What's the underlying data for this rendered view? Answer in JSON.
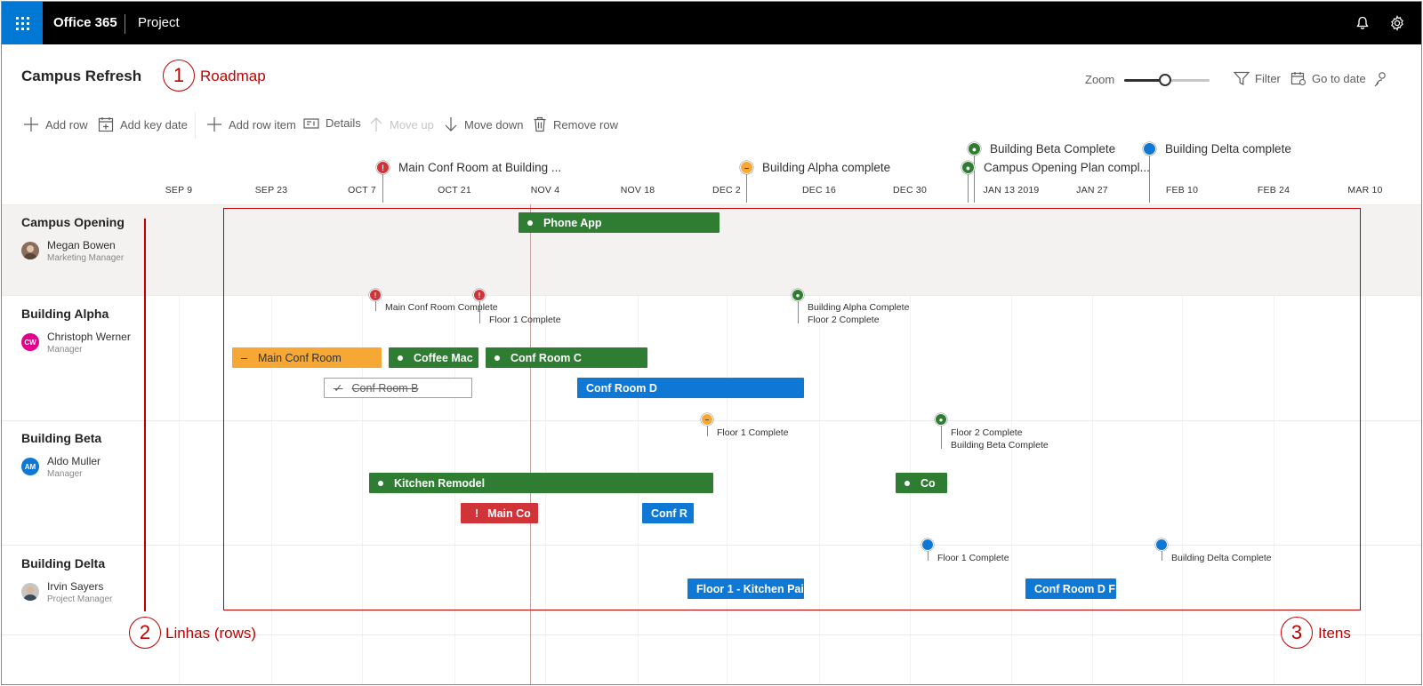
{
  "topbar": {
    "brand": "Office 365",
    "app": "Project"
  },
  "project": {
    "title": "Campus Refresh"
  },
  "callouts": [
    {
      "num": "1",
      "text": "Roadmap"
    },
    {
      "num": "2",
      "text": "Linhas (rows)"
    },
    {
      "num": "3",
      "text": "Itens"
    }
  ],
  "header": {
    "zoom_label": "Zoom",
    "zoom_level": 0.48,
    "filter": "Filter",
    "go_to_date": "Go to date"
  },
  "toolbar": {
    "add_row": "Add row",
    "add_key_date": "Add key date",
    "add_row_item": "Add row item",
    "details": "Details",
    "move_up": "Move up",
    "move_down": "Move down",
    "remove_row": "Remove row"
  },
  "timeline": {
    "dates": [
      "SEP 9",
      "SEP 23",
      "OCT 7",
      "OCT 21",
      "NOV 4",
      "NOV 18",
      "DEC 2",
      "DEC 16",
      "DEC 30",
      "JAN 13 2019",
      "JAN 27",
      "FEB 10",
      "FEB 24",
      "MAR 10"
    ],
    "key_dates": [
      "Main Conf Room at Building ...",
      "Building Alpha complete",
      "Building Beta Complete",
      "Campus Opening Plan compl...",
      "Building Delta complete"
    ]
  },
  "rows": [
    {
      "title": "Campus Opening",
      "person": "Megan Bowen",
      "role": "Marketing Manager",
      "initials": ""
    },
    {
      "title": "Building Alpha",
      "person": "Christoph Werner",
      "role": "Manager",
      "initials": "CW"
    },
    {
      "title": "Building Beta",
      "person": "Aldo Muller",
      "role": "Manager",
      "initials": "AM"
    },
    {
      "title": "Building Delta",
      "person": "Irvin Sayers",
      "role": "Project Manager",
      "initials": ""
    }
  ],
  "items": {
    "phone_app": "Phone App",
    "main_conf_room": "Main Conf Room",
    "coffee_mac": "Coffee Mac",
    "conf_room_c": "Conf Room C",
    "conf_room_b": "Conf Room B",
    "conf_room_d": "Conf Room D",
    "kitchen_remodel": "Kitchen Remodel",
    "co": "Co",
    "main_co": "Main Co",
    "conf_r": "Conf R",
    "floor1_kitchen": "Floor 1 - Kitchen Pai",
    "conf_room_d_f": "Conf Room D F"
  },
  "milestones": {
    "alpha_main_conf": "Main Conf Room Complete",
    "alpha_floor1": "Floor 1 Complete",
    "alpha_bac": "Building Alpha Complete",
    "alpha_floor2": "Floor 2 Complete",
    "beta_floor1": "Floor 1 Complete",
    "beta_floor2": "Floor 2 Complete",
    "beta_bbc": "Building Beta Complete",
    "delta_floor1": "Floor 1 Complete",
    "delta_bdc": "Building Delta Complete"
  },
  "colors": {
    "green": "#2e7d32",
    "orange": "#f7a733",
    "blue": "#0f78d4",
    "red": "#d13438",
    "accent": "#0078d4",
    "callout": "#c00000"
  },
  "today_marker": "NOV 4"
}
